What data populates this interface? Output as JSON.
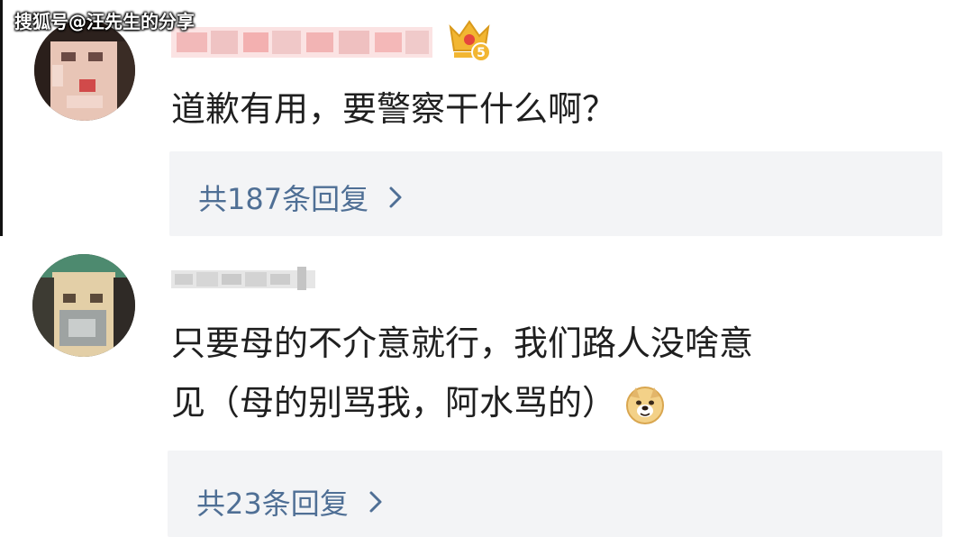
{
  "watermark": "搜狐号@汪先生的分享",
  "comments": [
    {
      "avatar_icon": "user-avatar-icon",
      "badge_icon": "crown-level-badge-icon",
      "badge_level": "5",
      "text_lines": [
        "道歉有用，要警察干什么啊？"
      ],
      "reply_label": "共187条回复"
    },
    {
      "avatar_icon": "user-avatar-icon",
      "text_lines": [
        "只要母的不介意就行，我们路人没啥意",
        "见（母的别骂我，阿水骂的）"
      ],
      "emoji_icon": "doge-emoji-icon",
      "reply_label": "共23条回复"
    }
  ],
  "colors": {
    "text": "#1f1f1f",
    "reply_link": "#4f6f95",
    "reply_bg": "#f3f4f6",
    "badge_gold": "#f2b632",
    "badge_red": "#e5463c"
  }
}
